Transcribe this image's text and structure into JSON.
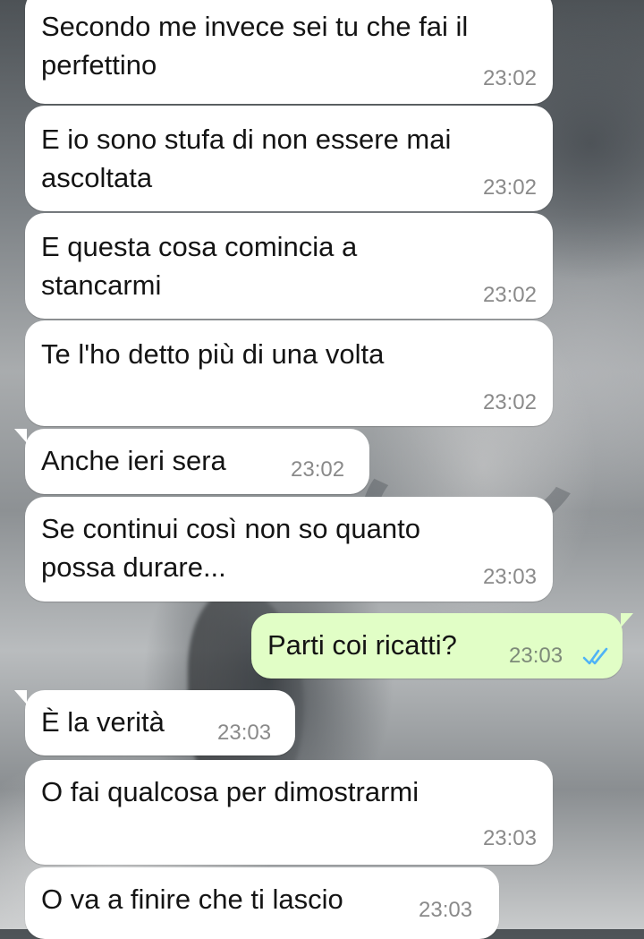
{
  "messages": [
    {
      "text": "Secondo me invece sei tu che fai il\nperfettino",
      "time": "23:02",
      "direction": "received"
    },
    {
      "text": "E io sono stufa di non essere mai\nascoltata",
      "time": "23:02",
      "direction": "received"
    },
    {
      "text": "E questa cosa comincia a\nstancarmi",
      "time": "23:02",
      "direction": "received"
    },
    {
      "text": "Te l'ho detto più di una volta",
      "time": "23:02",
      "direction": "received"
    },
    {
      "text": "Anche ieri sera",
      "time": "23:02",
      "direction": "received"
    },
    {
      "text": "Se continui così non so quanto\npossa durare...",
      "time": "23:03",
      "direction": "received"
    },
    {
      "text": "Parti coi ricatti?",
      "time": "23:03",
      "direction": "sent",
      "status_icon": "double-check-icon",
      "status": "read"
    },
    {
      "text": "È la verità",
      "time": "23:03",
      "direction": "received"
    },
    {
      "text": "O fai qualcosa per dimostrarmi",
      "time": "23:03",
      "direction": "received"
    },
    {
      "text": "O va a finire che ti lascio",
      "time": "23:03",
      "direction": "received"
    }
  ],
  "colors": {
    "received_bubble": "#ffffff",
    "sent_bubble": "#e1fec6",
    "read_check": "#4fb3f6"
  }
}
